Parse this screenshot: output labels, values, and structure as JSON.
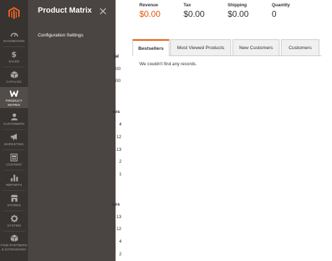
{
  "nav": {
    "items": [
      {
        "label": "DASHBOARD",
        "icon": "dashboard-icon"
      },
      {
        "label": "SALES",
        "icon": "dollar-icon"
      },
      {
        "label": "CATALOG",
        "icon": "box-icon"
      },
      {
        "label": "PRODUCT MATRIX",
        "icon": "product-matrix-icon",
        "active": true
      },
      {
        "label": "CUSTOMERS",
        "icon": "customers-icon"
      },
      {
        "label": "MARKETING",
        "icon": "megaphone-icon"
      },
      {
        "label": "CONTENT",
        "icon": "content-icon"
      },
      {
        "label": "REPORTS",
        "icon": "reports-icon"
      },
      {
        "label": "STORES",
        "icon": "store-icon"
      },
      {
        "label": "SYSTEM",
        "icon": "gear-icon"
      },
      {
        "label": "FIND PARTNERS & EXTENSIONS",
        "icon": "partners-icon"
      }
    ]
  },
  "panel": {
    "title": "Product Matrix",
    "link": "Configuration Settings"
  },
  "partial": {
    "header_tal": "tal",
    "row1": ".00",
    "row2": ".00",
    "header_ses1": "ses",
    "col_a": [
      "4",
      "12",
      "13",
      "2",
      "1"
    ],
    "header_ses2": "ses",
    "col_b": [
      "13",
      "12",
      "4",
      "2"
    ]
  },
  "totals": [
    {
      "label": "Revenue",
      "value": "$0.00",
      "accent": "#eb5202"
    },
    {
      "label": "Tax",
      "value": "$0.00"
    },
    {
      "label": "Shipping",
      "value": "$0.00"
    },
    {
      "label": "Quantity",
      "value": "0"
    }
  ],
  "tabs": [
    {
      "label": "Bestsellers",
      "active": true
    },
    {
      "label": "Most Viewed Products"
    },
    {
      "label": "New Customers"
    },
    {
      "label": "Customers"
    }
  ],
  "empty_message": "We couldn't find any records.",
  "colors": {
    "accent": "#eb5202",
    "nav_bg": "#373330",
    "panel_bg": "#4a4542"
  }
}
